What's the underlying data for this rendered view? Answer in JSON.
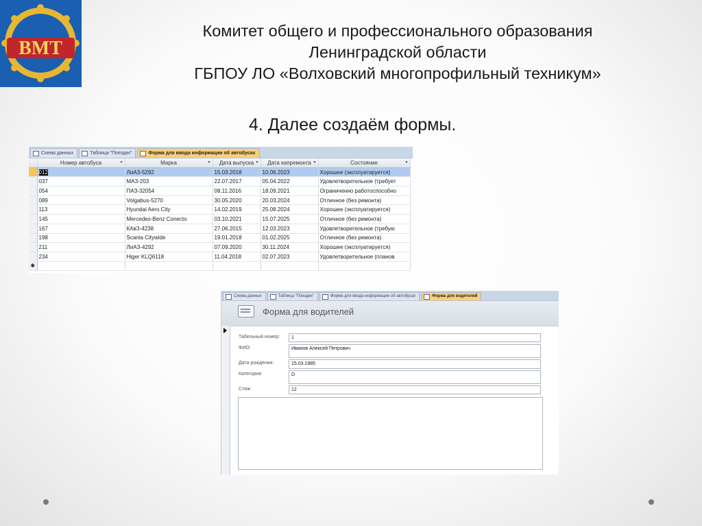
{
  "header": {
    "line1": "Комитет общего и профессионального образования",
    "line2": "Ленинградской области",
    "line3": "ГБПОУ ЛО  «Волховский многопрофильный техникум»"
  },
  "step_text": "4. Далее создаём формы.",
  "logo": {
    "text": "ВМТ",
    "colors": {
      "bg": "#1a5fb0",
      "gold": "#e7b733",
      "red": "#c0262c"
    }
  },
  "datasheet": {
    "tabs": [
      {
        "label": "Схема данных",
        "active": false
      },
      {
        "label": "Таблица \"Поездки\"",
        "active": false
      },
      {
        "label": "Форма для ввода информации об автобусах",
        "active": true
      }
    ],
    "columns": [
      "Номер автобуса",
      "Марка",
      "Дата выпуска",
      "Дата капремонта",
      "Состояние"
    ],
    "rows": [
      [
        "012",
        "ЛиАЗ-5292",
        "15.03.2018",
        "10.06.2023",
        "Хорошее (эксплуатируется)"
      ],
      [
        "037",
        "МАЗ-203",
        "22.07.2017",
        "05.04.2022",
        "Удовлетворительное (требует"
      ],
      [
        "054",
        "ПАЗ-32054",
        "08.11.2016",
        "18.09.2021",
        "Ограниченно работоспособно"
      ],
      [
        "089",
        "Volgabus-5270",
        "30.05.2020",
        "20.03.2024",
        "Отличное (без ремонта)"
      ],
      [
        "113",
        "Hyundai Aero City",
        "14.02.2019",
        "25.08.2024",
        "Хорошее (эксплуатируется)"
      ],
      [
        "145",
        "Mercedes-Benz Conecto",
        "03.10.2021",
        "15.07.2025",
        "Отличное (без ремонта)"
      ],
      [
        "167",
        "КАвЗ-4238",
        "27.06.2015",
        "12.03.2023",
        "Удовлетворительное (требую"
      ],
      [
        "198",
        "Scania Citywide",
        "19.01.2018",
        "01.02.2025",
        "Отличное (без ремонта)"
      ],
      [
        "211",
        "ЛиАЗ-4292",
        "07.09.2020",
        "30.11.2024",
        "Хорошее (эксплуатируется)"
      ],
      [
        "234",
        "Higer KLQ6118",
        "11.04.2018",
        "02.07.2023",
        "Удовлетворительное (планов"
      ]
    ],
    "new_row_marker": "✱"
  },
  "driver_form": {
    "tabs": [
      {
        "label": "Схема данных",
        "active": false
      },
      {
        "label": "Таблица \"Поездки\"",
        "active": false
      },
      {
        "label": "Форма для ввода информации об автобусах",
        "active": false
      },
      {
        "label": "Форма для водителей",
        "active": true
      }
    ],
    "title": "Форма для водителей",
    "fields": [
      {
        "label": "Табельный номер:",
        "value": "1"
      },
      {
        "label": "ФИО:",
        "value": "Иванов Алексей Петрович"
      },
      {
        "label": "Дата рождения:",
        "value": "15.03.1985"
      },
      {
        "label": "Категория:",
        "value": "D"
      },
      {
        "label": "Стаж:",
        "value": "12"
      }
    ]
  }
}
